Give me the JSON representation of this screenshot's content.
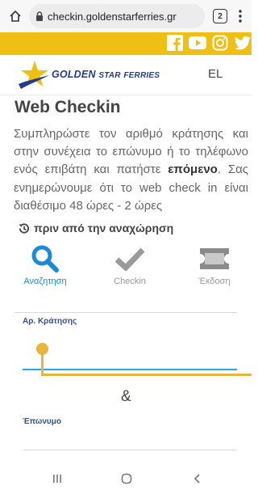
{
  "browser": {
    "url": "checkin.goldenstarferries.gr",
    "tab_count": "2"
  },
  "colors": {
    "brand_gold": "#f0bf13",
    "brand_blue": "#233c8e",
    "active_blue": "#1b8bd6",
    "inactive_gray": "#999999"
  },
  "social": [
    "facebook-icon",
    "youtube-icon",
    "instagram-icon",
    "twitter-icon"
  ],
  "header": {
    "logo_text_1": "GOLDEN",
    "logo_text_2": "STAR",
    "logo_text_3": "FERRIES",
    "language": "EL"
  },
  "main": {
    "title": "Web Checkin",
    "desc_1": "Συμπληρώστε τον αριθμό κράτησης και στην συνέχεια το επώνυμο ή το τηλέφωνο ενός επιβάτη και πατήστε ",
    "desc_bold": "επόμενο",
    "desc_2": ". Σας ενημερώνουμε ότι το web check in είναι διαθέσιμο 48 ώρες - 2 ώρες",
    "departure_text": "πριν από την αναχώρηση"
  },
  "steps": [
    {
      "label": "Αναζητηση",
      "icon": "search-icon",
      "active": true
    },
    {
      "label": "Checkin",
      "icon": "checkmark-icon",
      "active": false
    },
    {
      "label": "Έκδοση",
      "icon": "ticket-icon",
      "active": false
    }
  ],
  "form": {
    "booking_label": "Αρ. Κράτησης",
    "booking_value": "",
    "separator": "&",
    "surname_label": "Έπωνυμο",
    "surname_value": ""
  }
}
